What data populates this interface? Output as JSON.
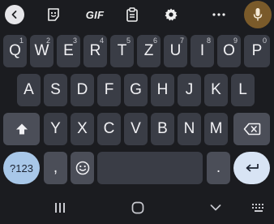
{
  "toolbar": {
    "gif_label": "GIF",
    "icons": [
      "back-icon",
      "sticker-icon",
      "gif-icon",
      "clipboard-icon",
      "settings-icon",
      "more-icon",
      "mic-icon"
    ],
    "mic_color": "#7a5a2a"
  },
  "rows": {
    "row1": [
      {
        "label": "Q",
        "hint": "1"
      },
      {
        "label": "W",
        "hint": "2"
      },
      {
        "label": "E",
        "hint": "3"
      },
      {
        "label": "R",
        "hint": "4"
      },
      {
        "label": "T",
        "hint": "5"
      },
      {
        "label": "Z",
        "hint": "6"
      },
      {
        "label": "U",
        "hint": "7"
      },
      {
        "label": "I",
        "hint": "8"
      },
      {
        "label": "O",
        "hint": "9"
      },
      {
        "label": "P",
        "hint": "0"
      }
    ],
    "row2": [
      "A",
      "S",
      "D",
      "F",
      "G",
      "H",
      "J",
      "K",
      "L"
    ],
    "row3": [
      "Y",
      "X",
      "C",
      "V",
      "B",
      "N",
      "M"
    ],
    "row4": {
      "symbols_label": "?123",
      "comma": ",",
      "period": "."
    }
  },
  "colors": {
    "background": "#1b1c20",
    "key": "#3a3d46",
    "key_dark": "#4b4e58",
    "symbols_key": "#a8c7e8",
    "enter_key": "#d8e4f4"
  },
  "navbar": {
    "icons": [
      "recent-apps-icon",
      "home-icon",
      "hide-keyboard-icon",
      "keyboard-switch-icon"
    ]
  }
}
